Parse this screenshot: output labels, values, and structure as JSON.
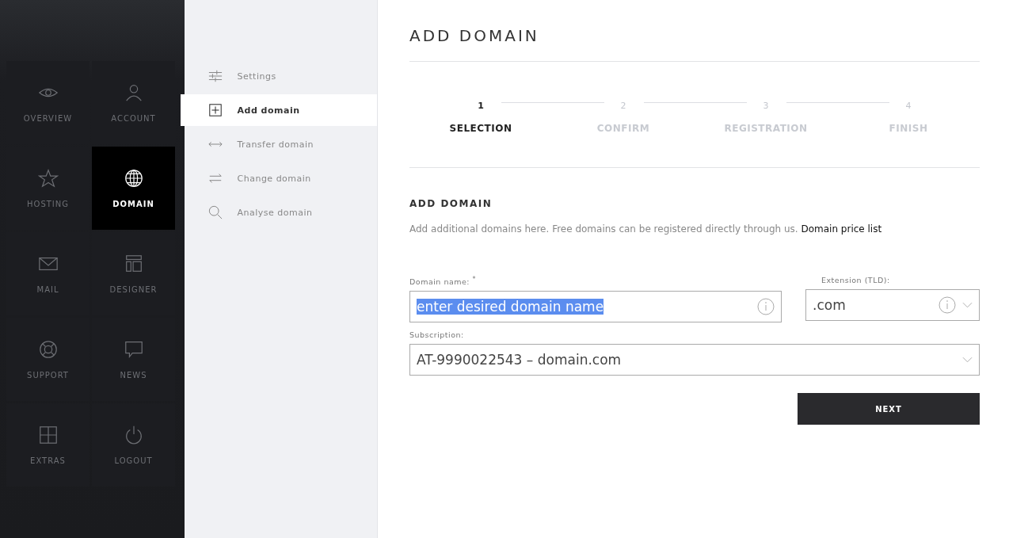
{
  "nav_tiles": [
    {
      "label": "OVERVIEW",
      "kind": "eye",
      "selected": false
    },
    {
      "label": "ACCOUNT",
      "kind": "person",
      "selected": false
    },
    {
      "label": "HOSTING",
      "kind": "star",
      "selected": false
    },
    {
      "label": "DOMAIN",
      "kind": "globe",
      "selected": true
    },
    {
      "label": "MAIL",
      "kind": "envelope",
      "selected": false
    },
    {
      "label": "DESIGNER",
      "kind": "layout",
      "selected": false
    },
    {
      "label": "SUPPORT",
      "kind": "lifebuoy",
      "selected": false
    },
    {
      "label": "NEWS",
      "kind": "speech",
      "selected": false
    },
    {
      "label": "EXTRAS",
      "kind": "plusbox",
      "selected": false
    },
    {
      "label": "LOGOUT",
      "kind": "power",
      "selected": false
    }
  ],
  "submenu": [
    {
      "label": "Settings",
      "kind": "sliders",
      "selected": false
    },
    {
      "label": "Add domain",
      "kind": "plusbox",
      "selected": true
    },
    {
      "label": "Transfer domain",
      "kind": "leftright",
      "selected": false
    },
    {
      "label": "Change domain",
      "kind": "swap",
      "selected": false
    },
    {
      "label": "Analyse domain",
      "kind": "search",
      "selected": false
    }
  ],
  "page_title": "ADD DOMAIN",
  "steps": [
    {
      "number": "1",
      "label": "SELECTION",
      "selected": true
    },
    {
      "number": "2",
      "label": "CONFIRM",
      "selected": false
    },
    {
      "number": "3",
      "label": "REGISTRATION",
      "selected": false
    },
    {
      "number": "4",
      "label": "FINISH",
      "selected": false
    }
  ],
  "section_title": "ADD DOMAIN",
  "description": "Add additional domains here. Free domains can be registered directly through us.",
  "price_link": "Domain price list",
  "domain_field": {
    "label": "Domain name:",
    "required_mark": "*",
    "value": "enter desired domain name"
  },
  "extension_field": {
    "label": "Extension (TLD):",
    "value": ".com"
  },
  "subscription_field": {
    "label": "Subscription:",
    "value": "AT-9990022543 – domain.com"
  },
  "next_button": "NEXT"
}
